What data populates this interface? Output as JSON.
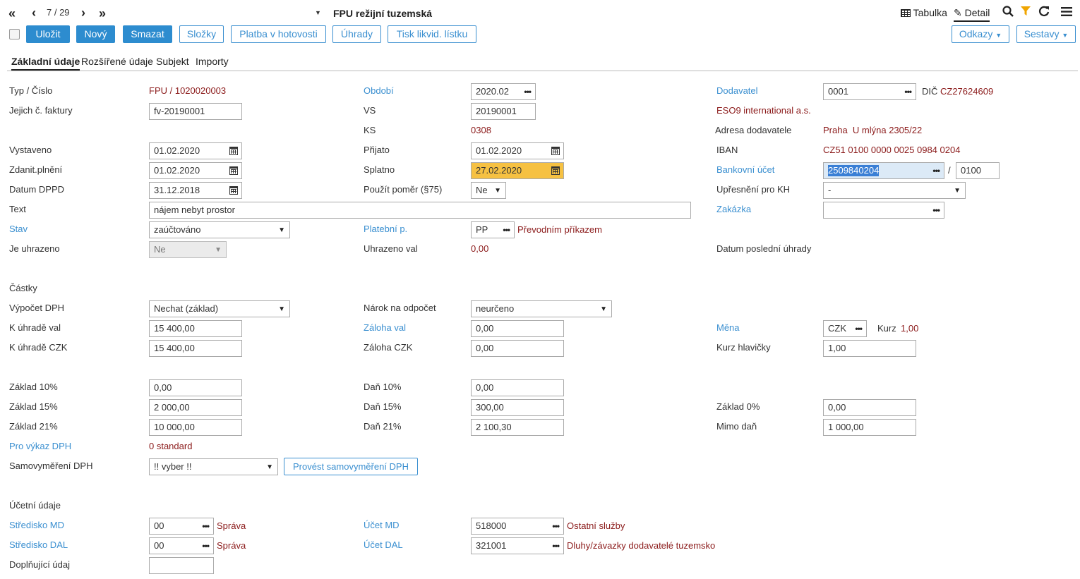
{
  "nav": {
    "counter": "7 / 29",
    "title": "FPU režijní tuzemská"
  },
  "views": {
    "table_label": "Tabulka",
    "detail_label": "Detail"
  },
  "toolbar": {
    "save": "Uložit",
    "new": "Nový",
    "delete": "Smazat",
    "folders": "Složky",
    "cash_payment": "Platba v hotovosti",
    "payments": "Úhrady",
    "print_slip": "Tisk likvid. lístku",
    "links": "Odkazy",
    "reports": "Sestavy"
  },
  "tabs": [
    "Základní údaje",
    "Rozšířené údaje",
    "Subjekt",
    "Importy"
  ],
  "col1": {
    "typ_cislo_label": "Typ / Číslo",
    "typ_cislo_value": "FPU / 1020020003",
    "jejich_label": "Jejich č. faktury",
    "jejich_value": "fv-20190001",
    "vystaveno_label": "Vystaveno",
    "vystaveno_value": "01.02.2020",
    "zdanit_label": "Zdanit.plnění",
    "zdanit_value": "01.02.2020",
    "dppd_label": "Datum DPPD",
    "dppd_value": "31.12.2018",
    "text_label": "Text",
    "text_value": "nájem nebyt prostor",
    "stav_label": "Stav",
    "stav_value": "zaúčtováno",
    "uhrazeno_label": "Je uhrazeno",
    "uhrazeno_value": "Ne"
  },
  "col2": {
    "obdobi_label": "Období",
    "obdobi_value": "2020.02",
    "vs_label": "VS",
    "vs_value": "20190001",
    "ks_label": "KS",
    "ks_value": "0308",
    "prijato_label": "Přijato",
    "prijato_value": "01.02.2020",
    "splatno_label": "Splatno",
    "splatno_value": "27.02.2020",
    "pomer_label": "Použít poměr (§75)",
    "pomer_value": "Ne",
    "platebni_label": "Platební p.",
    "platebni_code": "PP",
    "platebni_desc": "Převodním příkazem",
    "uhrazeno_val_label": "Uhrazeno val",
    "uhrazeno_val_value": "0,00"
  },
  "col3": {
    "dodavatel_label": "Dodavatel",
    "dodavatel_value": "0001",
    "dic_label": "DIČ",
    "dic_value": "CZ27624609",
    "firma": "ESO9 international a.s.",
    "adresa_label": "Adresa dodavatele",
    "adresa_value": "Praha  U mlýna 2305/22",
    "iban_label": "IBAN",
    "iban_value": "CZ51 0100 0000 0025 0984 0204",
    "ucet_label": "Bankovní účet",
    "ucet_value": "2509840204",
    "ucet_slash": "/",
    "ucet_bank": "0100",
    "upresneni_label": "Upřesnění pro KH",
    "upresneni_value": "-",
    "zakazka_label": "Zakázka",
    "zakazka_value": "",
    "posledni_label": "Datum poslední úhrady"
  },
  "castky": {
    "section": "Částky",
    "vypocet_label": "Výpočet DPH",
    "vypocet_value": "Nechat (základ)",
    "k_uhrade_val_label": "K úhradě val",
    "k_uhrade_val_value": "15 400,00",
    "k_uhrade_czk_label": "K úhradě CZK",
    "k_uhrade_czk_value": "15 400,00",
    "narok_label": "Nárok na odpočet",
    "narok_value": "neurčeno",
    "zaloha_val_label": "Záloha val",
    "zaloha_val_value": "0,00",
    "zaloha_czk_label": "Záloha CZK",
    "zaloha_czk_value": "0,00",
    "mena_label": "Měna",
    "mena_value": "CZK",
    "kurz_label": "Kurz",
    "kurz_value": "1,00",
    "kurz_hl_label": "Kurz hlavičky",
    "kurz_hl_value": "1,00"
  },
  "dph": {
    "z10_label": "Základ 10%",
    "z10_value": "0,00",
    "z15_label": "Základ 15%",
    "z15_value": "2 000,00",
    "z21_label": "Základ 21%",
    "z21_value": "10 000,00",
    "d10_label": "Daň 10%",
    "d10_value": "0,00",
    "d15_label": "Daň 15%",
    "d15_value": "300,00",
    "d21_label": "Daň 21%",
    "d21_value": "2 100,30",
    "z0_label": "Základ 0%",
    "z0_value": "0,00",
    "mimo_label": "Mimo daň",
    "mimo_value": "1 000,00",
    "vykaz_label": "Pro výkaz DPH",
    "vykaz_value": "0 standard",
    "samo_label": "Samovyměření DPH",
    "samo_value": "!! vyber !!",
    "samo_button": "Provést samovyměření DPH"
  },
  "ucetni": {
    "section": "Účetní údaje",
    "stred_md_label": "Středisko MD",
    "stred_md_value": "00",
    "stred_md_desc": "Správa",
    "stred_dal_label": "Středisko DAL",
    "stred_dal_value": "00",
    "stred_dal_desc": "Správa",
    "dopl_label": "Doplňující údaj",
    "dopl_value": "",
    "ucet_md_label": "Účet MD",
    "ucet_md_value": "518000",
    "ucet_md_desc": "Ostatní služby",
    "ucet_dal_label": "Účet DAL",
    "ucet_dal_value": "321001",
    "ucet_dal_desc": "Dluhy/závazky dodavatelé tuzemsko"
  }
}
